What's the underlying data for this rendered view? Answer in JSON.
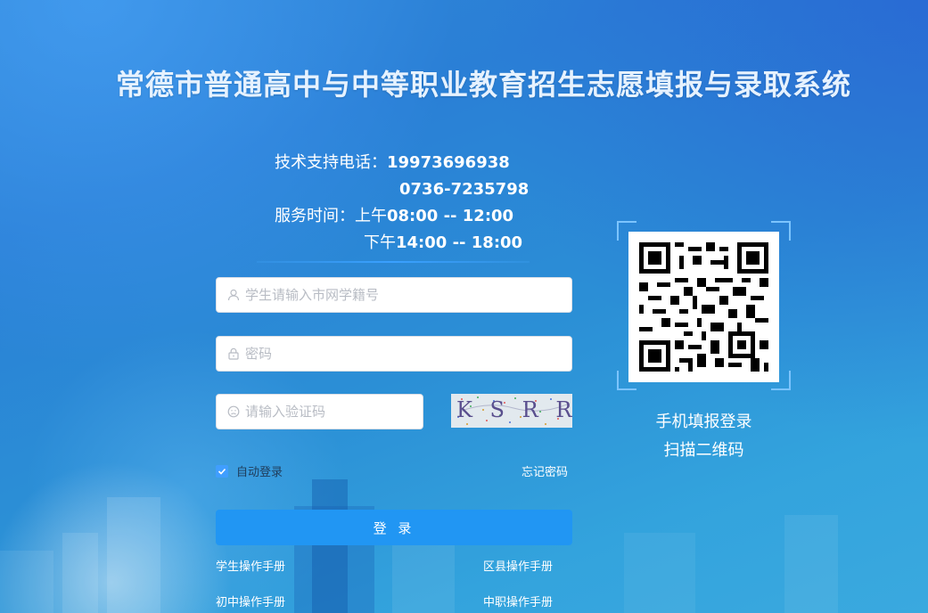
{
  "title": "常德市普通高中与中等职业教育招生志愿填报与录取系统",
  "support": {
    "phone_label": "技术支持电话：",
    "phone1": "19973696938",
    "phone2": "0736-7235798",
    "time_label": "服务时间：",
    "morning_prefix": "上午",
    "morning": "08:00 -- 12:00",
    "afternoon_prefix": "下午",
    "afternoon": "14:00 -- 18:00"
  },
  "form": {
    "username_placeholder": "学生请输入市网学籍号",
    "password_placeholder": "密码",
    "captcha_placeholder": "请输入验证码",
    "captcha_text": "K S R R",
    "remember_label": "自动登录",
    "remember_checked": true,
    "forgot_label": "忘记密码",
    "login_label": "登 录"
  },
  "manuals": {
    "student": "学生操作手册",
    "district": "区县操作手册",
    "junior": "初中操作手册",
    "vocational": "中职操作手册"
  },
  "qr": {
    "line1": "手机填报登录",
    "line2": "扫描二维码"
  },
  "colors": {
    "accent": "#2196f3",
    "checkbox": "#409eff",
    "title": "#e6f2ff"
  }
}
